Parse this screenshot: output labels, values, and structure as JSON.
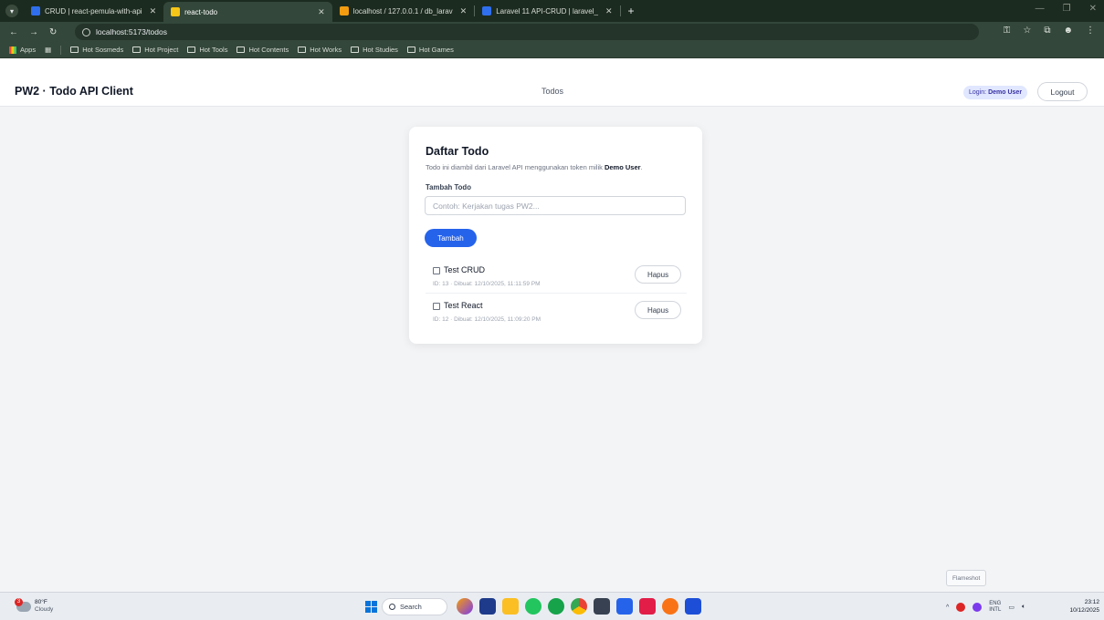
{
  "browser": {
    "tabs": [
      {
        "title": "CRUD | react-pemula-with-api",
        "favicon_color": "#2f6fed",
        "active": false
      },
      {
        "title": "react-todo",
        "favicon_color": "#f5c518",
        "active": true
      },
      {
        "title": "localhost / 127.0.0.1 / db_larav",
        "favicon_color": "#f39c12",
        "active": false
      },
      {
        "title": "Laravel 11 API-CRUD | laravel_",
        "favicon_color": "#2f6fed",
        "active": false
      }
    ],
    "url": "localhost:5173/todos",
    "bookmarks": [
      "Hot Sosmeds",
      "Hot Project",
      "Hot Tools",
      "Hot Contents",
      "Hot Works",
      "Hot Studies",
      "Hot Games"
    ],
    "apps_label": "Apps"
  },
  "header": {
    "brand": "PW2 · Todo API Client",
    "nav_todos": "Todos",
    "login_prefix": "Login:",
    "login_user": "Demo User",
    "logout_label": "Logout"
  },
  "card": {
    "title": "Daftar Todo",
    "subtitle_prefix": "Todo ini diambil dari Laravel API menggunakan token milik",
    "subtitle_user": "Demo User",
    "field_label": "Tambah Todo",
    "input_placeholder": "Contoh: Kerjakan tugas PW2...",
    "add_button": "Tambah",
    "todos": [
      {
        "title": "Test CRUD",
        "meta": "ID: 13 · Dibuat: 12/10/2025, 11:11:59 PM",
        "done": false,
        "delete_label": "Hapus"
      },
      {
        "title": "Test React",
        "meta": "ID: 12 · Dibuat: 12/10/2025, 11:09:20 PM",
        "done": false,
        "delete_label": "Hapus"
      }
    ]
  },
  "tooltip": "Flameshot",
  "taskbar": {
    "temp": "80°F",
    "condition": "Cloudy",
    "weather_badge": "3",
    "search_label": "Search",
    "lang_top": "ENG",
    "lang_bottom": "INTL",
    "time": "23:12",
    "date": "10/12/2025"
  },
  "colors": {
    "accent": "#2563eb",
    "browser_frame": "#33473a"
  }
}
